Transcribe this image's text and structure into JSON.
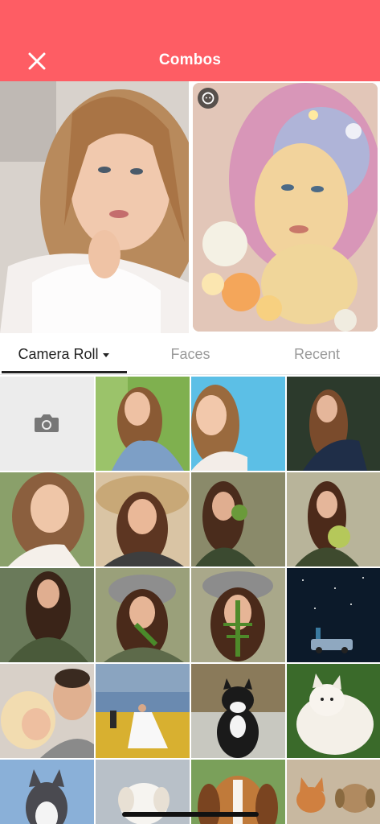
{
  "header": {
    "title": "Combos",
    "close_icon": "close-icon",
    "background": "#fe5d64"
  },
  "preview": {
    "original_label": "original-photo",
    "art_label": "art-filtered-photo",
    "art_badge_icon": "face-filter-icon"
  },
  "tabs": [
    {
      "label": "Camera Roll",
      "active": true
    },
    {
      "label": "Faces",
      "active": false
    },
    {
      "label": "Recent",
      "active": false
    }
  ],
  "grid": {
    "camera_icon": "camera-icon",
    "photos": [
      "woman-denim-jacket",
      "woman-blue-background",
      "woman-dark-forest",
      "woman-smiling-portrait",
      "woman-straw-hat",
      "woman-holding-plant",
      "woman-holding-flowers",
      "woman-green-sweater",
      "woman-grey-hat-leaf",
      "woman-hat-fern-face",
      "car-under-stars",
      "couple-embrace",
      "wedding-sunflower-field",
      "black-white-cat",
      "white-dog-grass",
      "husky-snow",
      "white-fluffy-dog",
      "beagle",
      "small-dogs-pair"
    ]
  }
}
